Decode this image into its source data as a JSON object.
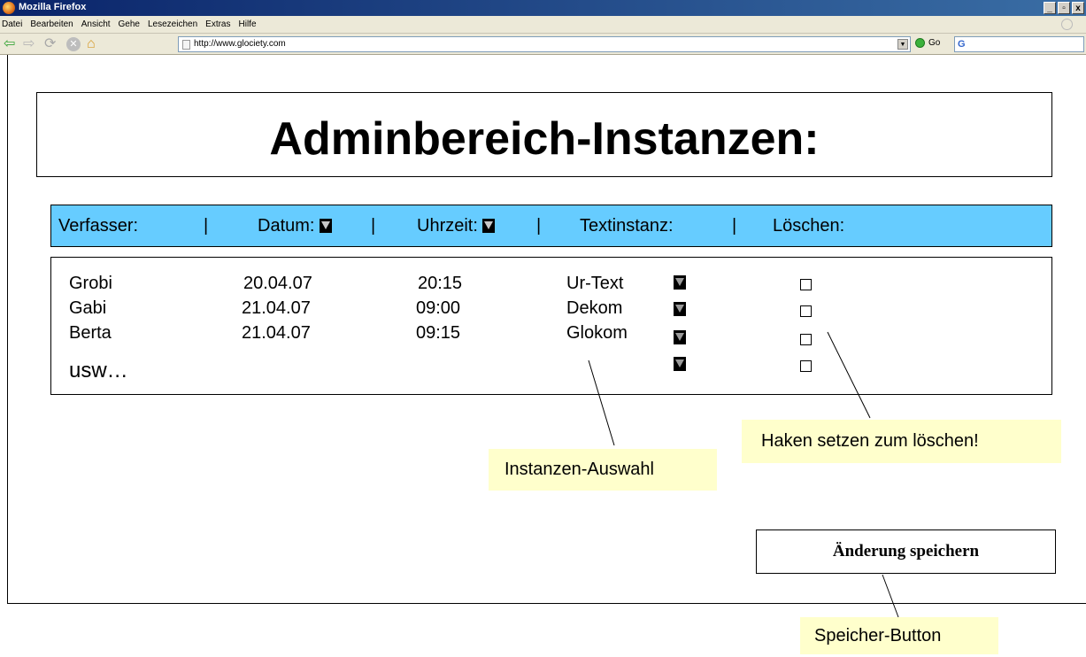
{
  "window": {
    "title": "Mozilla Firefox",
    "minimize": "_",
    "restore": "▫",
    "close": "x"
  },
  "menu": [
    "Datei",
    "Bearbeiten",
    "Ansicht",
    "Gehe",
    "Lesezeichen",
    "Extras",
    "Hilfe"
  ],
  "toolbar": {
    "url": "http://www.glociety.com",
    "go_label": "Go",
    "search_value": "G"
  },
  "icons": {
    "back": "back-arrow-icon",
    "forward": "forward-arrow-icon",
    "reload": "reload-icon",
    "stop": "stop-icon",
    "home": "home-icon"
  },
  "page": {
    "title": "Adminbereich-Instanzen:",
    "header": {
      "author": "Verfasser:",
      "sep": "|",
      "date": "Datum:",
      "time": "Uhrzeit:",
      "instance": "Textinstanz:",
      "delete": "Löschen:"
    },
    "rows": [
      {
        "author": "Grobi",
        "date": "20.04.07",
        "time": "20:15",
        "instance": "Ur-Text"
      },
      {
        "author": "Gabi",
        "date": "21.04.07",
        "time": "09:00",
        "instance": "Dekom"
      },
      {
        "author": "Berta",
        "date": "21.04.07",
        "time": "09:15",
        "instance": "Glokom"
      }
    ],
    "more": "usw…",
    "save_button": "Änderung speichern"
  },
  "annotations": {
    "instances": "Instanzen-Auswahl",
    "delete_hint": "Haken setzen zum löschen!",
    "save_hint": "Speicher-Button"
  },
  "colors": {
    "header_bg": "#66ccff",
    "note_bg": "#ffffcc"
  }
}
